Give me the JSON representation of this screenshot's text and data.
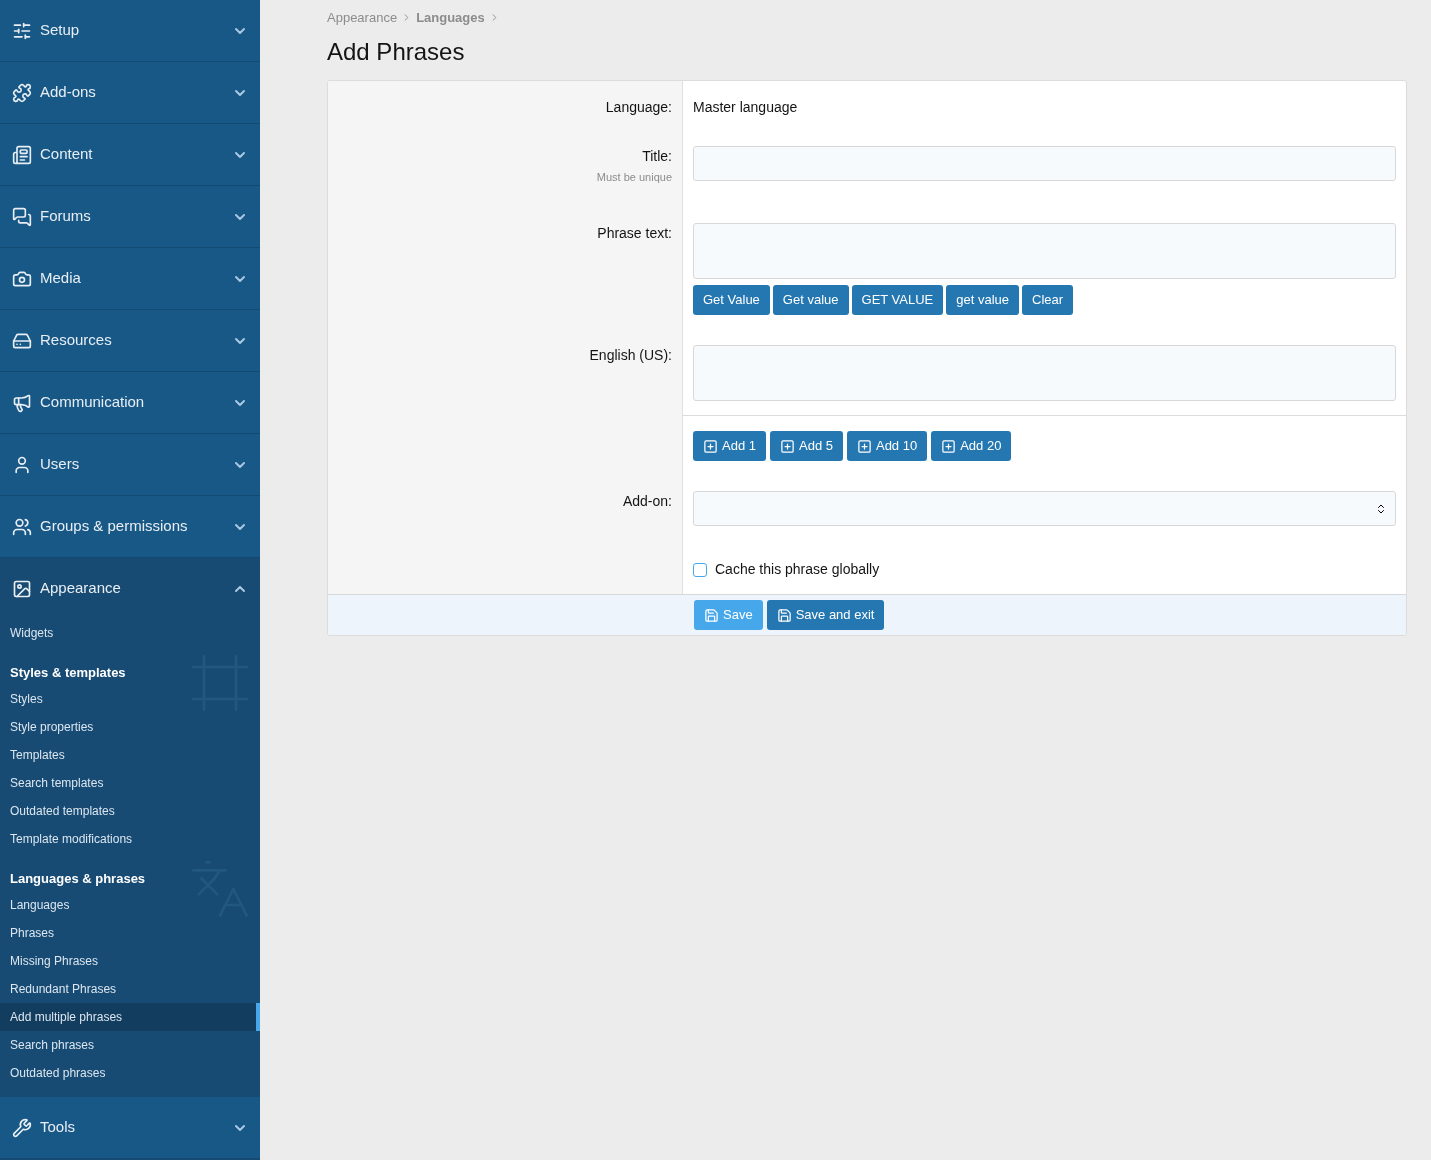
{
  "sidebar": {
    "sections": [
      {
        "label": "Setup",
        "expanded": false
      },
      {
        "label": "Add-ons",
        "expanded": false
      },
      {
        "label": "Content",
        "expanded": false
      },
      {
        "label": "Forums",
        "expanded": false
      },
      {
        "label": "Media",
        "expanded": false
      },
      {
        "label": "Resources",
        "expanded": false
      },
      {
        "label": "Communication",
        "expanded": false
      },
      {
        "label": "Users",
        "expanded": false
      },
      {
        "label": "Groups & permissions",
        "expanded": false
      },
      {
        "label": "Appearance",
        "expanded": true,
        "groups": [
          {
            "items": [
              {
                "label": "Widgets",
                "selected": false
              }
            ]
          },
          {
            "heading": "Styles & templates",
            "items": [
              {
                "label": "Styles",
                "selected": false
              },
              {
                "label": "Style properties",
                "selected": false
              },
              {
                "label": "Templates",
                "selected": false
              },
              {
                "label": "Search templates",
                "selected": false
              },
              {
                "label": "Outdated templates",
                "selected": false
              },
              {
                "label": "Template modifications",
                "selected": false
              }
            ]
          },
          {
            "heading": "Languages & phrases",
            "items": [
              {
                "label": "Languages",
                "selected": false
              },
              {
                "label": "Phrases",
                "selected": false
              },
              {
                "label": "Missing Phrases",
                "selected": false
              },
              {
                "label": "Redundant Phrases",
                "selected": false
              },
              {
                "label": "Add multiple phrases",
                "selected": true
              },
              {
                "label": "Search phrases",
                "selected": false
              },
              {
                "label": "Outdated phrases",
                "selected": false
              }
            ]
          }
        ]
      },
      {
        "label": "Tools",
        "expanded": false
      }
    ]
  },
  "breadcrumb": [
    "Appearance",
    "Languages"
  ],
  "title": "Add Phrases",
  "form": {
    "language": {
      "label": "Language:",
      "value": "Master language"
    },
    "title": {
      "label": "Title:",
      "hint": "Must be unique"
    },
    "phrase_text": {
      "label": "Phrase text:",
      "buttons": [
        "Get Value",
        "Get value",
        "GET VALUE",
        "get value",
        "Clear"
      ]
    },
    "english": {
      "label": "English (US):"
    },
    "add_buttons": [
      "Add 1",
      "Add 5",
      "Add 10",
      "Add 20"
    ],
    "addon": {
      "label": "Add-on:"
    },
    "cache": {
      "label": "Cache this phrase globally",
      "checked": false
    },
    "actions": [
      {
        "label": "Save",
        "kind": "primary"
      },
      {
        "label": "Save and exit",
        "kind": "secondary"
      }
    ]
  }
}
